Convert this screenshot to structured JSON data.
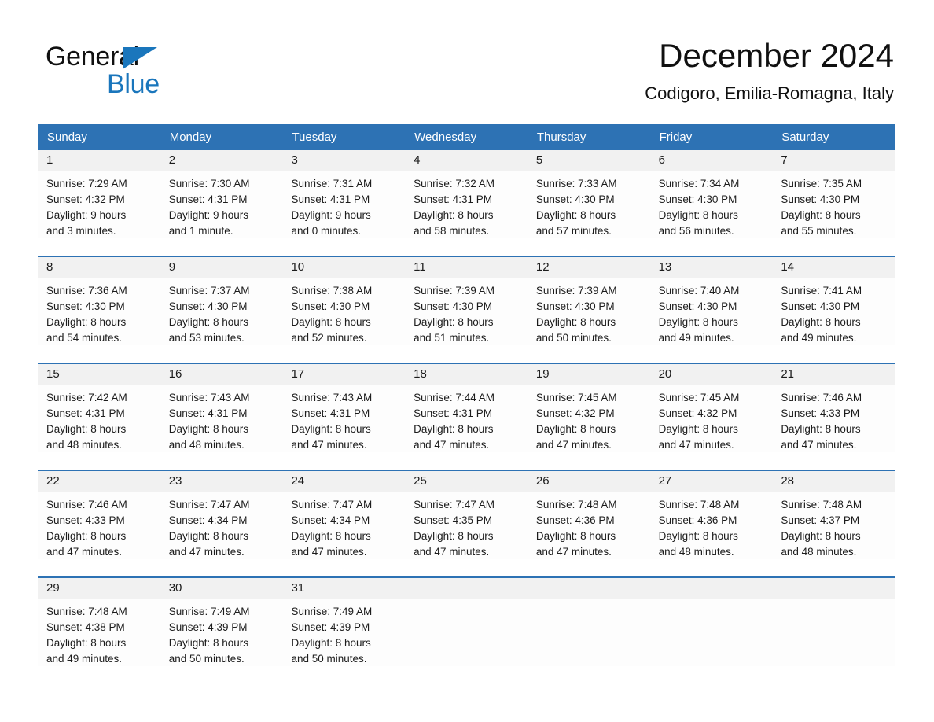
{
  "brand": {
    "name_part1": "General",
    "name_part2": "Blue",
    "flag_icon": "triangle-flag-icon",
    "accent_color": "#1a76bc"
  },
  "header": {
    "title": "December 2024",
    "subtitle": "Codigoro, Emilia-Romagna, Italy"
  },
  "calendar": {
    "header_bg": "#2d72b4",
    "day_band_bg": "#f1f1f1",
    "weekdays": [
      "Sunday",
      "Monday",
      "Tuesday",
      "Wednesday",
      "Thursday",
      "Friday",
      "Saturday"
    ],
    "weeks": [
      [
        {
          "day": "1",
          "sunrise": "Sunrise: 7:29 AM",
          "sunset": "Sunset: 4:32 PM",
          "daylight_line1": "Daylight: 9 hours",
          "daylight_line2": "and 3 minutes."
        },
        {
          "day": "2",
          "sunrise": "Sunrise: 7:30 AM",
          "sunset": "Sunset: 4:31 PM",
          "daylight_line1": "Daylight: 9 hours",
          "daylight_line2": "and 1 minute."
        },
        {
          "day": "3",
          "sunrise": "Sunrise: 7:31 AM",
          "sunset": "Sunset: 4:31 PM",
          "daylight_line1": "Daylight: 9 hours",
          "daylight_line2": "and 0 minutes."
        },
        {
          "day": "4",
          "sunrise": "Sunrise: 7:32 AM",
          "sunset": "Sunset: 4:31 PM",
          "daylight_line1": "Daylight: 8 hours",
          "daylight_line2": "and 58 minutes."
        },
        {
          "day": "5",
          "sunrise": "Sunrise: 7:33 AM",
          "sunset": "Sunset: 4:30 PM",
          "daylight_line1": "Daylight: 8 hours",
          "daylight_line2": "and 57 minutes."
        },
        {
          "day": "6",
          "sunrise": "Sunrise: 7:34 AM",
          "sunset": "Sunset: 4:30 PM",
          "daylight_line1": "Daylight: 8 hours",
          "daylight_line2": "and 56 minutes."
        },
        {
          "day": "7",
          "sunrise": "Sunrise: 7:35 AM",
          "sunset": "Sunset: 4:30 PM",
          "daylight_line1": "Daylight: 8 hours",
          "daylight_line2": "and 55 minutes."
        }
      ],
      [
        {
          "day": "8",
          "sunrise": "Sunrise: 7:36 AM",
          "sunset": "Sunset: 4:30 PM",
          "daylight_line1": "Daylight: 8 hours",
          "daylight_line2": "and 54 minutes."
        },
        {
          "day": "9",
          "sunrise": "Sunrise: 7:37 AM",
          "sunset": "Sunset: 4:30 PM",
          "daylight_line1": "Daylight: 8 hours",
          "daylight_line2": "and 53 minutes."
        },
        {
          "day": "10",
          "sunrise": "Sunrise: 7:38 AM",
          "sunset": "Sunset: 4:30 PM",
          "daylight_line1": "Daylight: 8 hours",
          "daylight_line2": "and 52 minutes."
        },
        {
          "day": "11",
          "sunrise": "Sunrise: 7:39 AM",
          "sunset": "Sunset: 4:30 PM",
          "daylight_line1": "Daylight: 8 hours",
          "daylight_line2": "and 51 minutes."
        },
        {
          "day": "12",
          "sunrise": "Sunrise: 7:39 AM",
          "sunset": "Sunset: 4:30 PM",
          "daylight_line1": "Daylight: 8 hours",
          "daylight_line2": "and 50 minutes."
        },
        {
          "day": "13",
          "sunrise": "Sunrise: 7:40 AM",
          "sunset": "Sunset: 4:30 PM",
          "daylight_line1": "Daylight: 8 hours",
          "daylight_line2": "and 49 minutes."
        },
        {
          "day": "14",
          "sunrise": "Sunrise: 7:41 AM",
          "sunset": "Sunset: 4:30 PM",
          "daylight_line1": "Daylight: 8 hours",
          "daylight_line2": "and 49 minutes."
        }
      ],
      [
        {
          "day": "15",
          "sunrise": "Sunrise: 7:42 AM",
          "sunset": "Sunset: 4:31 PM",
          "daylight_line1": "Daylight: 8 hours",
          "daylight_line2": "and 48 minutes."
        },
        {
          "day": "16",
          "sunrise": "Sunrise: 7:43 AM",
          "sunset": "Sunset: 4:31 PM",
          "daylight_line1": "Daylight: 8 hours",
          "daylight_line2": "and 48 minutes."
        },
        {
          "day": "17",
          "sunrise": "Sunrise: 7:43 AM",
          "sunset": "Sunset: 4:31 PM",
          "daylight_line1": "Daylight: 8 hours",
          "daylight_line2": "and 47 minutes."
        },
        {
          "day": "18",
          "sunrise": "Sunrise: 7:44 AM",
          "sunset": "Sunset: 4:31 PM",
          "daylight_line1": "Daylight: 8 hours",
          "daylight_line2": "and 47 minutes."
        },
        {
          "day": "19",
          "sunrise": "Sunrise: 7:45 AM",
          "sunset": "Sunset: 4:32 PM",
          "daylight_line1": "Daylight: 8 hours",
          "daylight_line2": "and 47 minutes."
        },
        {
          "day": "20",
          "sunrise": "Sunrise: 7:45 AM",
          "sunset": "Sunset: 4:32 PM",
          "daylight_line1": "Daylight: 8 hours",
          "daylight_line2": "and 47 minutes."
        },
        {
          "day": "21",
          "sunrise": "Sunrise: 7:46 AM",
          "sunset": "Sunset: 4:33 PM",
          "daylight_line1": "Daylight: 8 hours",
          "daylight_line2": "and 47 minutes."
        }
      ],
      [
        {
          "day": "22",
          "sunrise": "Sunrise: 7:46 AM",
          "sunset": "Sunset: 4:33 PM",
          "daylight_line1": "Daylight: 8 hours",
          "daylight_line2": "and 47 minutes."
        },
        {
          "day": "23",
          "sunrise": "Sunrise: 7:47 AM",
          "sunset": "Sunset: 4:34 PM",
          "daylight_line1": "Daylight: 8 hours",
          "daylight_line2": "and 47 minutes."
        },
        {
          "day": "24",
          "sunrise": "Sunrise: 7:47 AM",
          "sunset": "Sunset: 4:34 PM",
          "daylight_line1": "Daylight: 8 hours",
          "daylight_line2": "and 47 minutes."
        },
        {
          "day": "25",
          "sunrise": "Sunrise: 7:47 AM",
          "sunset": "Sunset: 4:35 PM",
          "daylight_line1": "Daylight: 8 hours",
          "daylight_line2": "and 47 minutes."
        },
        {
          "day": "26",
          "sunrise": "Sunrise: 7:48 AM",
          "sunset": "Sunset: 4:36 PM",
          "daylight_line1": "Daylight: 8 hours",
          "daylight_line2": "and 47 minutes."
        },
        {
          "day": "27",
          "sunrise": "Sunrise: 7:48 AM",
          "sunset": "Sunset: 4:36 PM",
          "daylight_line1": "Daylight: 8 hours",
          "daylight_line2": "and 48 minutes."
        },
        {
          "day": "28",
          "sunrise": "Sunrise: 7:48 AM",
          "sunset": "Sunset: 4:37 PM",
          "daylight_line1": "Daylight: 8 hours",
          "daylight_line2": "and 48 minutes."
        }
      ],
      [
        {
          "day": "29",
          "sunrise": "Sunrise: 7:48 AM",
          "sunset": "Sunset: 4:38 PM",
          "daylight_line1": "Daylight: 8 hours",
          "daylight_line2": "and 49 minutes."
        },
        {
          "day": "30",
          "sunrise": "Sunrise: 7:49 AM",
          "sunset": "Sunset: 4:39 PM",
          "daylight_line1": "Daylight: 8 hours",
          "daylight_line2": "and 50 minutes."
        },
        {
          "day": "31",
          "sunrise": "Sunrise: 7:49 AM",
          "sunset": "Sunset: 4:39 PM",
          "daylight_line1": "Daylight: 8 hours",
          "daylight_line2": "and 50 minutes."
        },
        {
          "day": "",
          "sunrise": "",
          "sunset": "",
          "daylight_line1": "",
          "daylight_line2": ""
        },
        {
          "day": "",
          "sunrise": "",
          "sunset": "",
          "daylight_line1": "",
          "daylight_line2": ""
        },
        {
          "day": "",
          "sunrise": "",
          "sunset": "",
          "daylight_line1": "",
          "daylight_line2": ""
        },
        {
          "day": "",
          "sunrise": "",
          "sunset": "",
          "daylight_line1": "",
          "daylight_line2": ""
        }
      ]
    ]
  }
}
